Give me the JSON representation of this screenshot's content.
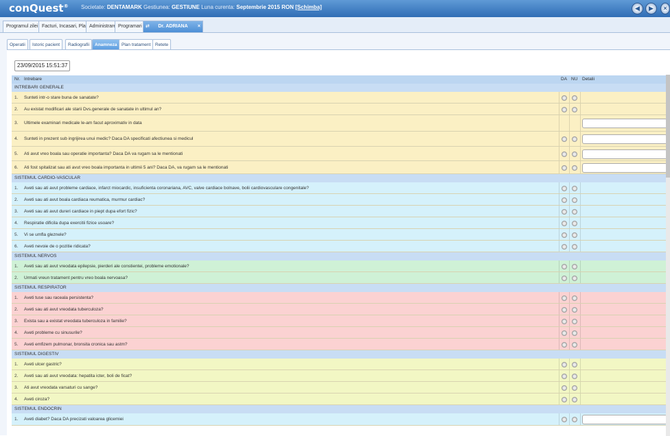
{
  "header": {
    "logo": "conQuest",
    "logo_reg": "®",
    "societate_label": "Societate:",
    "societate": "DENTAMARK",
    "gestiunea_label": "Gestiunea:",
    "gestiunea": "GESTIUNE",
    "luna_label": "Luna curenta:",
    "luna": "Septembrie 2015",
    "moneda": "RON",
    "change_link": "[Schimba]"
  },
  "main_tabs": [
    {
      "label": "Programul zilei"
    },
    {
      "label": "Facturi, Incasari, Plati"
    },
    {
      "label": "Administrare"
    },
    {
      "label": "Programari"
    },
    {
      "label": "Dr. ADRIANA",
      "active": true
    }
  ],
  "sub_tabs": [
    {
      "label": "Operatii"
    },
    {
      "label": "Istoric pacient"
    },
    {
      "label": "Radiografii"
    },
    {
      "label": "Anamneza",
      "active": true
    },
    {
      "label": "Plan tratament"
    },
    {
      "label": "Retete"
    }
  ],
  "date_value": "23/09/2015 15:51:37",
  "columns": {
    "nr": "Nr.",
    "intrebare": "Intrebare",
    "da": "DA",
    "nu": "NU",
    "detalii": "Detalii"
  },
  "sections": [
    {
      "title": "INTREBARI GENERALE",
      "color": "#fbf0c4",
      "questions": [
        {
          "nr": "1.",
          "text": "Sunteti intr-o stare buna de sanatate?",
          "radios": true,
          "detail": false
        },
        {
          "nr": "2.",
          "text": "Au existat modificari ale starii Dvs.generale de sanatate in ultimul an?",
          "radios": true,
          "detail": false
        },
        {
          "nr": "3.",
          "text": "Ultimele examinari medicale le-am facut aproximativ in data",
          "radios": false,
          "detail": true
        },
        {
          "nr": "4.",
          "text": "Sunteti in prezent sub ingrijirea unui medic? Daca DA specificati afectiunea si medicul",
          "radios": true,
          "detail": true
        },
        {
          "nr": "5.",
          "text": "Ati avut vreo boala sau operatie importanta? Daca DA va rugam sa le mentionati",
          "radios": true,
          "detail": true
        },
        {
          "nr": "6.",
          "text": "Ati fost spitalizat sau ati avut vreo boala importanta in ultimii 5 ani? Daca DA, va rugam sa le mentionati",
          "radios": true,
          "detail": true
        }
      ]
    },
    {
      "title": "SISTEMUL CARDIO-VASCULAR",
      "color": "#d5f1fb",
      "questions": [
        {
          "nr": "1.",
          "text": "Aveti sau ati avut probleme cardiace, infarct miocardic, insuficienta coronariana, AVC, valve cardiace bolnave, bolii cardiovasculare congenitale?",
          "radios": true,
          "detail": false
        },
        {
          "nr": "2.",
          "text": "Aveti sau ati avut boala cardiaca reumatica, murmur cardiac?",
          "radios": true,
          "detail": false
        },
        {
          "nr": "3.",
          "text": "Aveti sau ati avut dureri cardiace in piept dupa efort fizic?",
          "radios": true,
          "detail": false
        },
        {
          "nr": "4.",
          "text": "Respiratie dificila dupa exercitii fizice usoare?",
          "radios": true,
          "detail": false
        },
        {
          "nr": "5.",
          "text": "Vi se umfla gleznele?",
          "radios": true,
          "detail": false
        },
        {
          "nr": "6.",
          "text": "Aveti nevoie de o pozitie ridicata?",
          "radios": true,
          "detail": false
        }
      ]
    },
    {
      "title": "SISTEMUL NERVOS",
      "color": "#cff1d6",
      "questions": [
        {
          "nr": "1.",
          "text": "Aveti sau ati avut vreodata epilepsie, pierderi ale constientei, probleme emotionale?",
          "radios": true,
          "detail": false
        },
        {
          "nr": "2.",
          "text": "Urmati vreun tratament pentru vreo boala nervoasa?",
          "radios": true,
          "detail": false
        }
      ]
    },
    {
      "title": "SISTEMUL RESPIRATOR",
      "color": "#fbd2d2",
      "questions": [
        {
          "nr": "1.",
          "text": "Aveti tuse sau raceala persistenta?",
          "radios": true,
          "detail": false
        },
        {
          "nr": "2.",
          "text": "Aveti sau ati avut vreodata tuberculoza?",
          "radios": true,
          "detail": false
        },
        {
          "nr": "3.",
          "text": "Exista sau a existat vreodata tuberculoza in familie?",
          "radios": true,
          "detail": false
        },
        {
          "nr": "4.",
          "text": "Aveti probleme cu sinusurile?",
          "radios": true,
          "detail": false
        },
        {
          "nr": "5.",
          "text": "Aveti emfizem pulmonar, bronsita cronica sau astm?",
          "radios": true,
          "detail": false
        }
      ]
    },
    {
      "title": "SISTEMUL DIGESTIV",
      "color": "#f2f7c4",
      "questions": [
        {
          "nr": "1.",
          "text": "Aveti ulcer gastric?",
          "radios": true,
          "detail": false
        },
        {
          "nr": "2.",
          "text": "Aveti sau ati avut vreodata: hepatita icter, boli de ficat?",
          "radios": true,
          "detail": false
        },
        {
          "nr": "3.",
          "text": "Ati avut vreodata varsaturi cu sange?",
          "radios": true,
          "detail": false
        },
        {
          "nr": "4.",
          "text": "Aveti ciroza?",
          "radios": true,
          "detail": false
        }
      ]
    },
    {
      "title": "SISTEMUL ENDOCRIN",
      "color": "#d5f1fb",
      "questions": [
        {
          "nr": "1.",
          "text": "Aveti diabet? Daca DA precizati valoarea glicemiei",
          "radios": true,
          "detail": true
        }
      ]
    }
  ]
}
